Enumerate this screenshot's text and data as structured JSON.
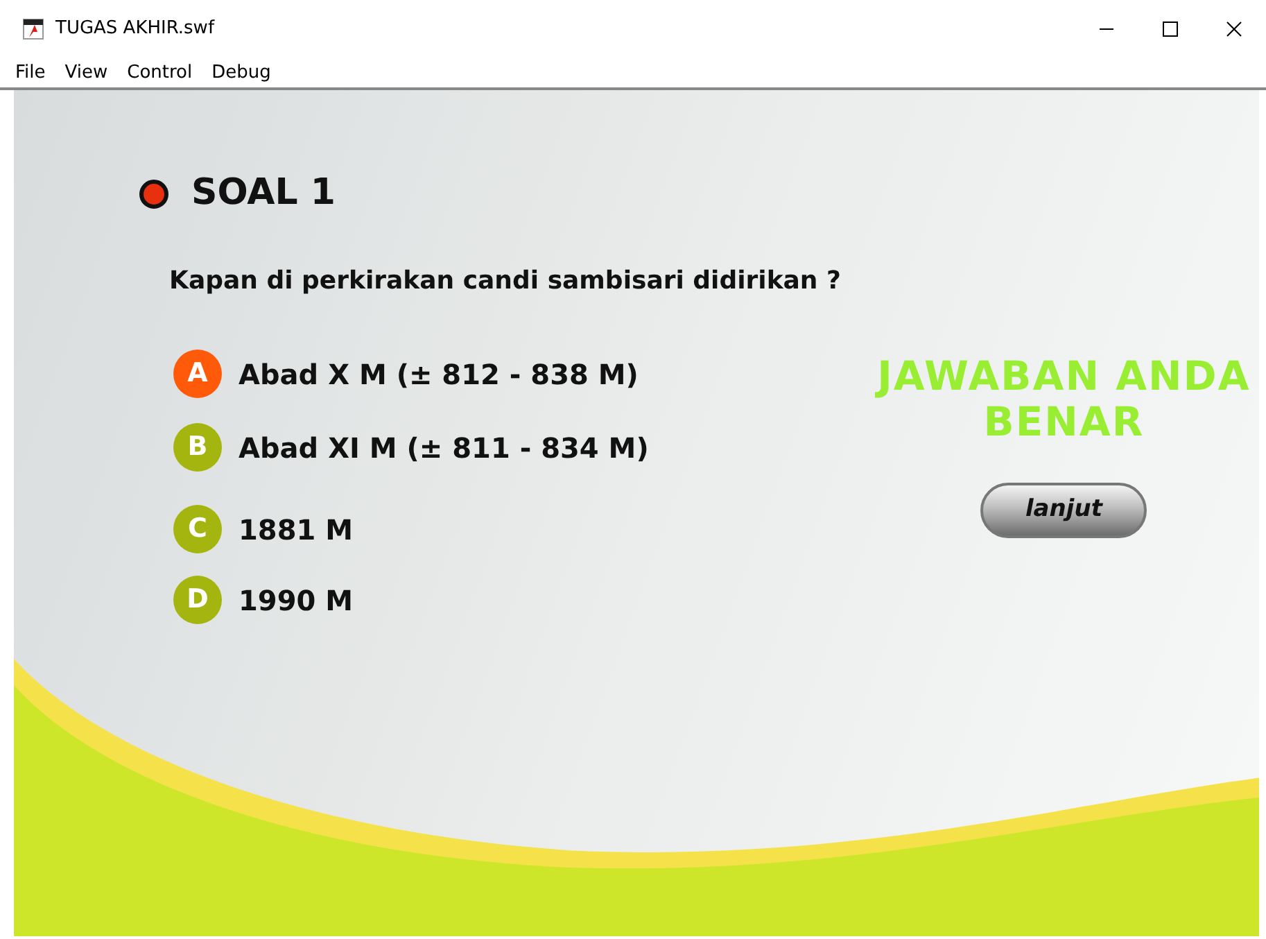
{
  "window": {
    "title": "TUGAS AKHIR.swf"
  },
  "menu": [
    "File",
    "View",
    "Control",
    "Debug"
  ],
  "quiz": {
    "heading": "SOAL 1",
    "question": "Kapan di perkirakan candi sambisari didirikan ?",
    "options": [
      {
        "letter": "A",
        "text": "Abad X M (± 812 - 838 M)",
        "selected": true
      },
      {
        "letter": "B",
        "text": "Abad XI M (± 811 - 834 M)",
        "selected": false
      },
      {
        "letter": "C",
        "text": "1881 M",
        "selected": false
      },
      {
        "letter": "D",
        "text": "1990 M",
        "selected": false
      }
    ],
    "result": "JAWABAN ANDA BENAR",
    "next_button": "lanjut"
  }
}
